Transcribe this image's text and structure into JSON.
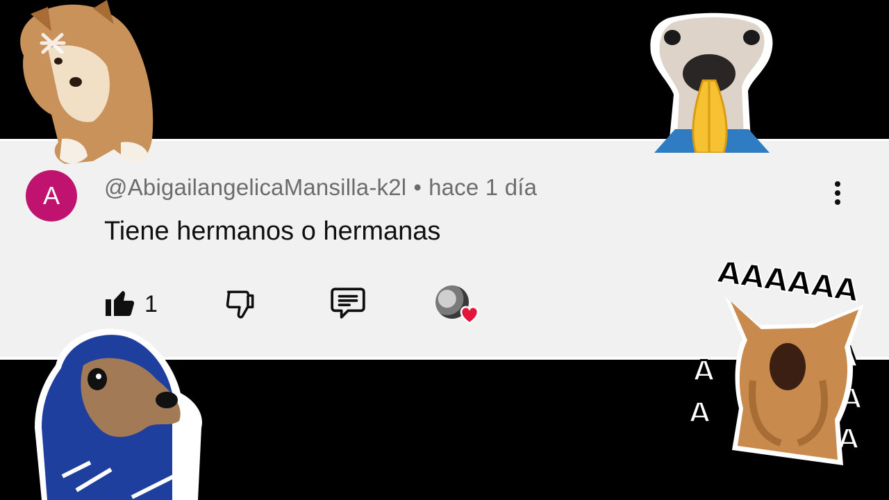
{
  "comment": {
    "avatar_letter": "A",
    "avatar_color": "#c0136f",
    "username": "@AbigailangelicaMansilla-k2l",
    "separator": "•",
    "time": "hace 1 día",
    "text": "Tiene hermanos o hermanas",
    "like_count": "1"
  },
  "icons": {
    "more": "more-vertical-icon",
    "like": "thumbs-up-filled-icon",
    "dislike": "thumbs-down-icon",
    "reply": "comment-reply-icon",
    "creator_heart": "heart-icon"
  },
  "stickers": {
    "scream_text": "AAAAAA"
  },
  "colors": {
    "card_bg": "#f1f1f1",
    "heart": "#e1163a",
    "background": "#000000"
  }
}
